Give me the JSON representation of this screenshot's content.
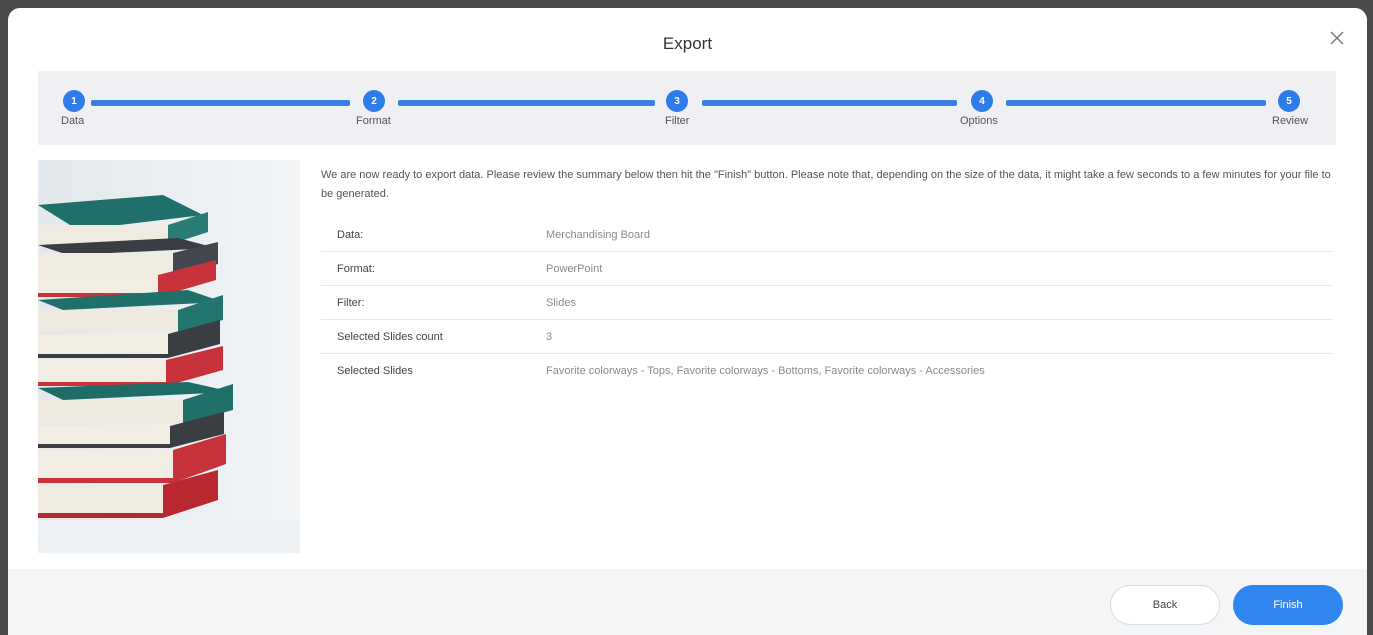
{
  "dialog": {
    "title": "Export",
    "close_icon": "close-icon"
  },
  "stepper": {
    "steps": [
      {
        "number": "1",
        "label": "Data"
      },
      {
        "number": "2",
        "label": "Format"
      },
      {
        "number": "3",
        "label": "Filter"
      },
      {
        "number": "4",
        "label": "Options"
      },
      {
        "number": "5",
        "label": "Review"
      }
    ],
    "active_color": "#2f7bea"
  },
  "summary": {
    "intro": "We are now ready to export data. Please review the summary below then hit the \"Finish\" button. Please note that, depending on the size of the data, it might take a few seconds to a few minutes for your file to be generated.",
    "rows": [
      {
        "label": "Data:",
        "value": "Merchandising Board"
      },
      {
        "label": "Format:",
        "value": "PowerPoint"
      },
      {
        "label": "Filter:",
        "value": "Slides"
      },
      {
        "label": "Selected Slides count",
        "value": "3"
      },
      {
        "label": "Selected Slides",
        "value": "Favorite colorways - Tops, Favorite colorways - Bottoms, Favorite colorways - Accessories"
      }
    ]
  },
  "footer": {
    "back_label": "Back",
    "finish_label": "Finish",
    "finish_color": "#2f86ee"
  }
}
